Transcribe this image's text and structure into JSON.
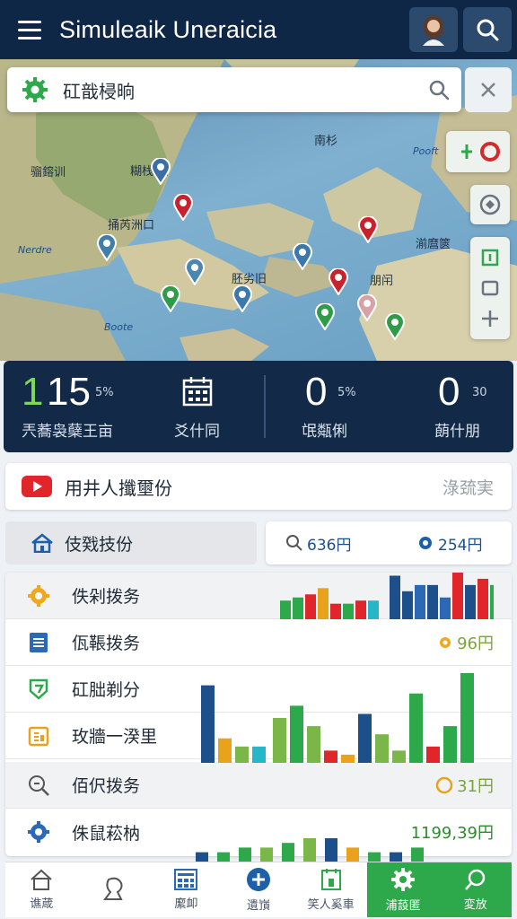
{
  "header": {
    "title": "Simuleaik Uneraicia"
  },
  "search": {
    "value": "矼戠梫晌"
  },
  "map_labels": {
    "l1": "南杉",
    "l2": "Pooft",
    "l3": "骝鎔训",
    "l4": "糊栈 刖",
    "l5": "捅芮洲口",
    "l6": "Nerdre",
    "l7": "胚劣旧",
    "l8": "湔麿篋",
    "l9": "朋闬",
    "l10": "Boote"
  },
  "stats": [
    {
      "value": "15",
      "suffix": "5%",
      "label": "兲蕎袅蘖王亩",
      "accent": "#7ed957"
    },
    {
      "value": "",
      "suffix": "",
      "label": "爻什同",
      "icon": "calendar-icon"
    },
    {
      "value": "0",
      "suffix": "5%",
      "label": "氓甐俐"
    },
    {
      "value": "0",
      "suffix": "30",
      "label": "蓢什朋"
    }
  ],
  "promo": {
    "text": "用井人攕壐份",
    "side": "淥巯実"
  },
  "tab_home": {
    "label": "伎戣技份"
  },
  "stat_pill": {
    "a": "636円",
    "b": "254円"
  },
  "list": [
    {
      "label": "佚剁拨务",
      "value": "",
      "icon": "gear-icon"
    },
    {
      "label": "佤䩨拨务",
      "value": "96円",
      "icon": "document-icon"
    },
    {
      "label": "矼朏剃分",
      "value": "",
      "icon": "shield-icon"
    },
    {
      "label": "玫牆一湀里",
      "value": "",
      "icon": "clipboard-icon"
    },
    {
      "label": "佰伬拨务",
      "value": "31円",
      "icon": "search-doc-icon"
    },
    {
      "label": "侏鼠菘枘",
      "value": "1199,39円",
      "icon": "settings-icon"
    }
  ],
  "bottom_nav": [
    {
      "label": "谯葴",
      "icon": "home-icon"
    },
    {
      "label": "",
      "icon": "profile-icon"
    },
    {
      "label": "緳卹",
      "icon": "calculator-icon"
    },
    {
      "label": "遺嵿",
      "icon": "plus-icon"
    },
    {
      "label": "笑人奚車",
      "icon": "document-icon"
    },
    {
      "label": "浦蔎匿",
      "icon": "gear-icon",
      "active": true
    },
    {
      "label": "変放",
      "icon": "search-icon",
      "active": true
    }
  ],
  "colors": {
    "header": "#0f2746",
    "accent_green": "#2da84a",
    "stats_bg": "#122a48"
  },
  "chart_data": [
    {
      "type": "bar",
      "values": [
        6,
        7,
        8,
        10,
        5,
        5,
        6,
        6,
        14,
        9,
        11,
        11,
        7,
        15,
        11,
        13,
        11
      ]
    },
    {
      "type": "bar",
      "values": [
        19,
        6,
        4,
        4,
        11,
        14,
        9,
        3,
        2,
        12,
        7,
        3,
        17,
        4,
        9,
        22
      ]
    },
    {
      "type": "bar",
      "values": [
        2,
        2,
        3,
        3,
        4,
        5,
        5,
        3,
        2,
        2,
        3
      ]
    }
  ]
}
